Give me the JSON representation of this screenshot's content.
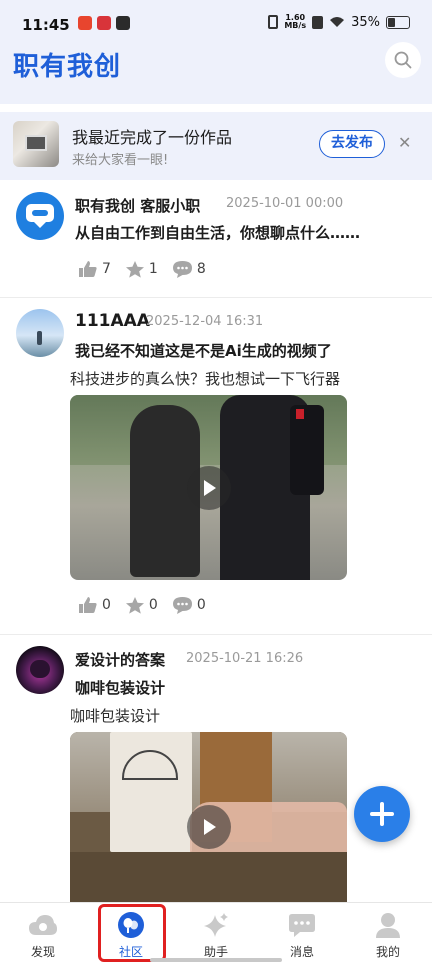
{
  "status_bar": {
    "time": "11:45",
    "speed": "1.60\nMB/s",
    "battery": "35%",
    "battery_level": 0.35
  },
  "header": {
    "title": "职有我创"
  },
  "promo": {
    "title": "我最近完成了一份作品",
    "subtitle": "来给大家看一眼!",
    "publish_label": "去发布",
    "close_label": "✕"
  },
  "posts": [
    {
      "author": "职有我创 客服小职",
      "time": "2025-10-01 00:00",
      "title": "从自由工作到自由生活，你想聊点什么……",
      "likes": "7",
      "stars": "1",
      "comments": "8"
    },
    {
      "author": "111AAA",
      "time": "2025-12-04 16:31",
      "title": "我已经不知道这是不是Ai生成的视频了",
      "body": "科技进步的真么快？我也想试一下飞行器",
      "likes": "0",
      "stars": "0",
      "comments": "0"
    },
    {
      "author": "爱设计的答案",
      "time": "2025-10-21 16:26",
      "title": "咖啡包装设计",
      "body": "咖啡包装设计"
    }
  ],
  "tabs": [
    {
      "label": "发现",
      "icon": "cloud-icon"
    },
    {
      "label": "社区",
      "icon": "community-icon",
      "active": true
    },
    {
      "label": "助手",
      "icon": "sparkle-icon"
    },
    {
      "label": "消息",
      "icon": "message-icon"
    },
    {
      "label": "我的",
      "icon": "person-icon"
    }
  ],
  "colors": {
    "brand": "#1f5fd8",
    "fab": "#2a7fe8",
    "highlight": "#e02020"
  }
}
